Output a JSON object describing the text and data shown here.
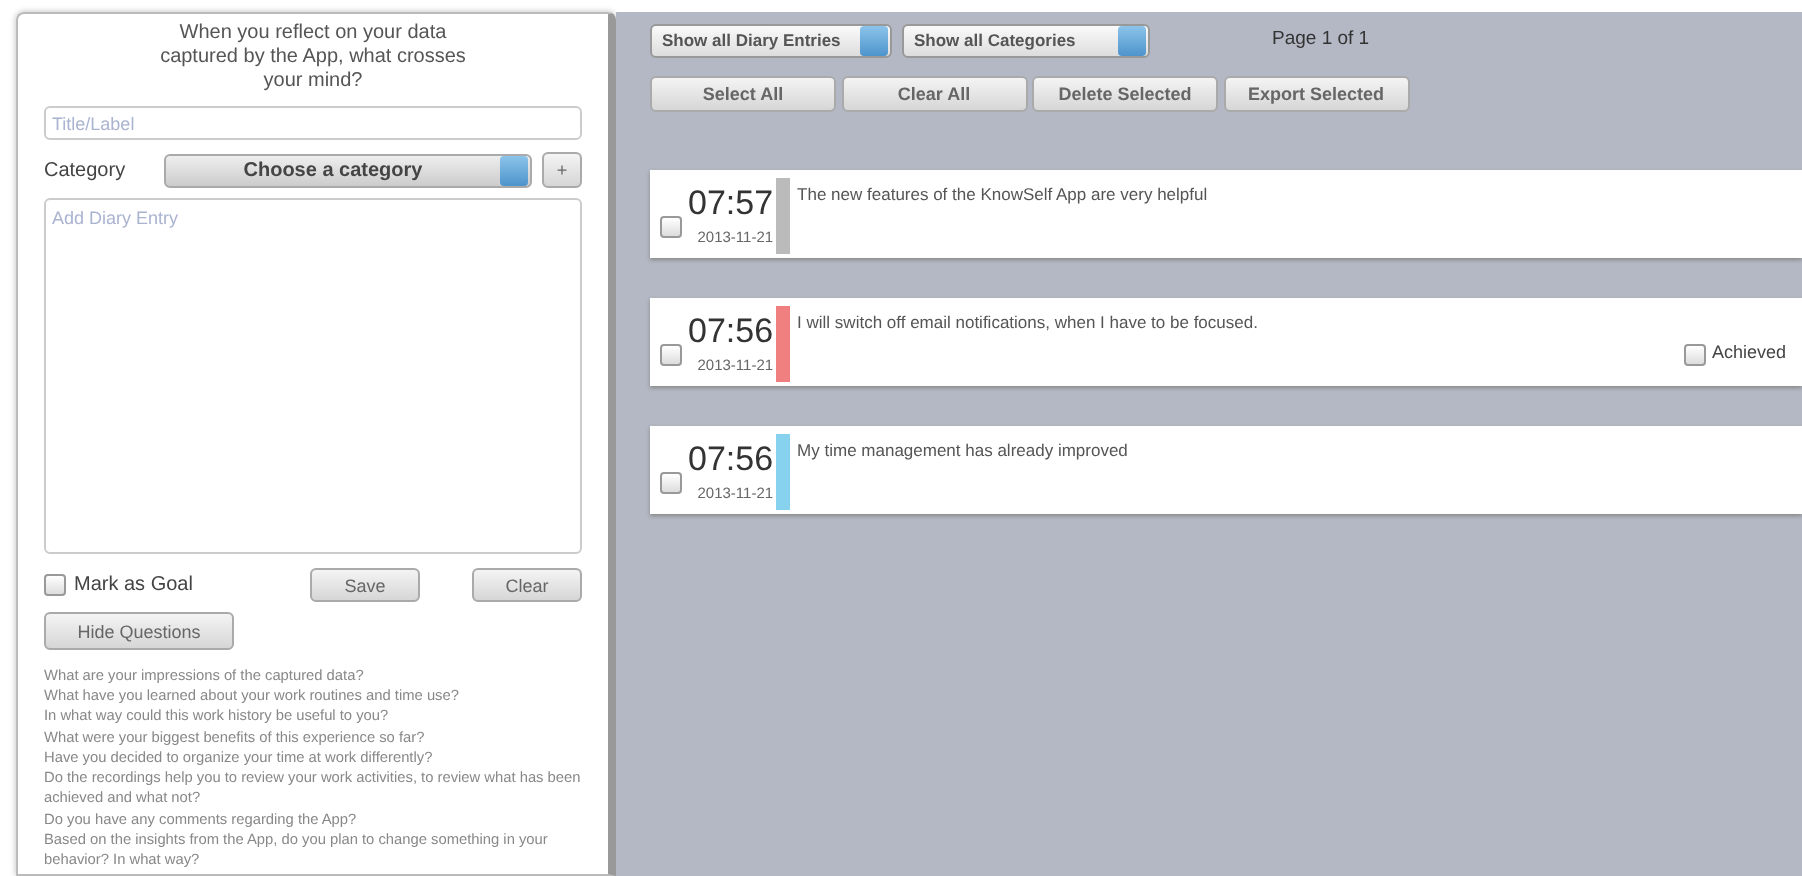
{
  "composer": {
    "prompt": "When you reflect on your data captured by the App, what crosses your mind?",
    "title_field": {
      "placeholder": "Title/Label"
    },
    "category_label": "Category",
    "category_select": {
      "value": "Choose a category"
    },
    "add_category_button": "+",
    "entry_field": {
      "placeholder": "Add Diary Entry"
    },
    "mark_as_goal": {
      "label": "Mark as Goal",
      "checked": false
    },
    "buttons": [
      "Save",
      "Clear"
    ],
    "hide_questions_button": "Hide Questions",
    "questions": [
      "What are your impressions of the captured data?",
      "What have you learned about your work routines and time use?",
      "In what way could this work history be useful to you?",
      "What were your biggest benefits of this experience so far?",
      "Have you decided to organize your time at work differently?",
      "Do the recordings help you to review your work activities, to review what has been achieved and what not?",
      "Do you have any comments regarding the App?",
      "Based on the insights from the App, do you plan to change something in your behavior? In what way?"
    ]
  },
  "toolbar": {
    "filters": [
      "Show all Diary Entries",
      "Show all Categories"
    ],
    "page": "Page 1 of 1",
    "buttons": [
      "Select All",
      "Clear All",
      "Delete Selected",
      "Export Selected"
    ]
  },
  "entries": [
    {
      "time": "07:57",
      "date": "2013-11-21",
      "color": "#bbbbbb",
      "text": "The new features of the KnowSelf App are very helpful",
      "checked": false
    },
    {
      "time": "07:56",
      "date": "2013-11-21",
      "color": "#f08080",
      "text": "I will switch off email notifications, when I have to be focused.",
      "checked": false,
      "achieved": {
        "label": "Achieved",
        "checked": false
      }
    },
    {
      "time": "07:56",
      "date": "2013-11-21",
      "color": "#87d3ef",
      "text": "My time management has already improved",
      "checked": false
    }
  ]
}
